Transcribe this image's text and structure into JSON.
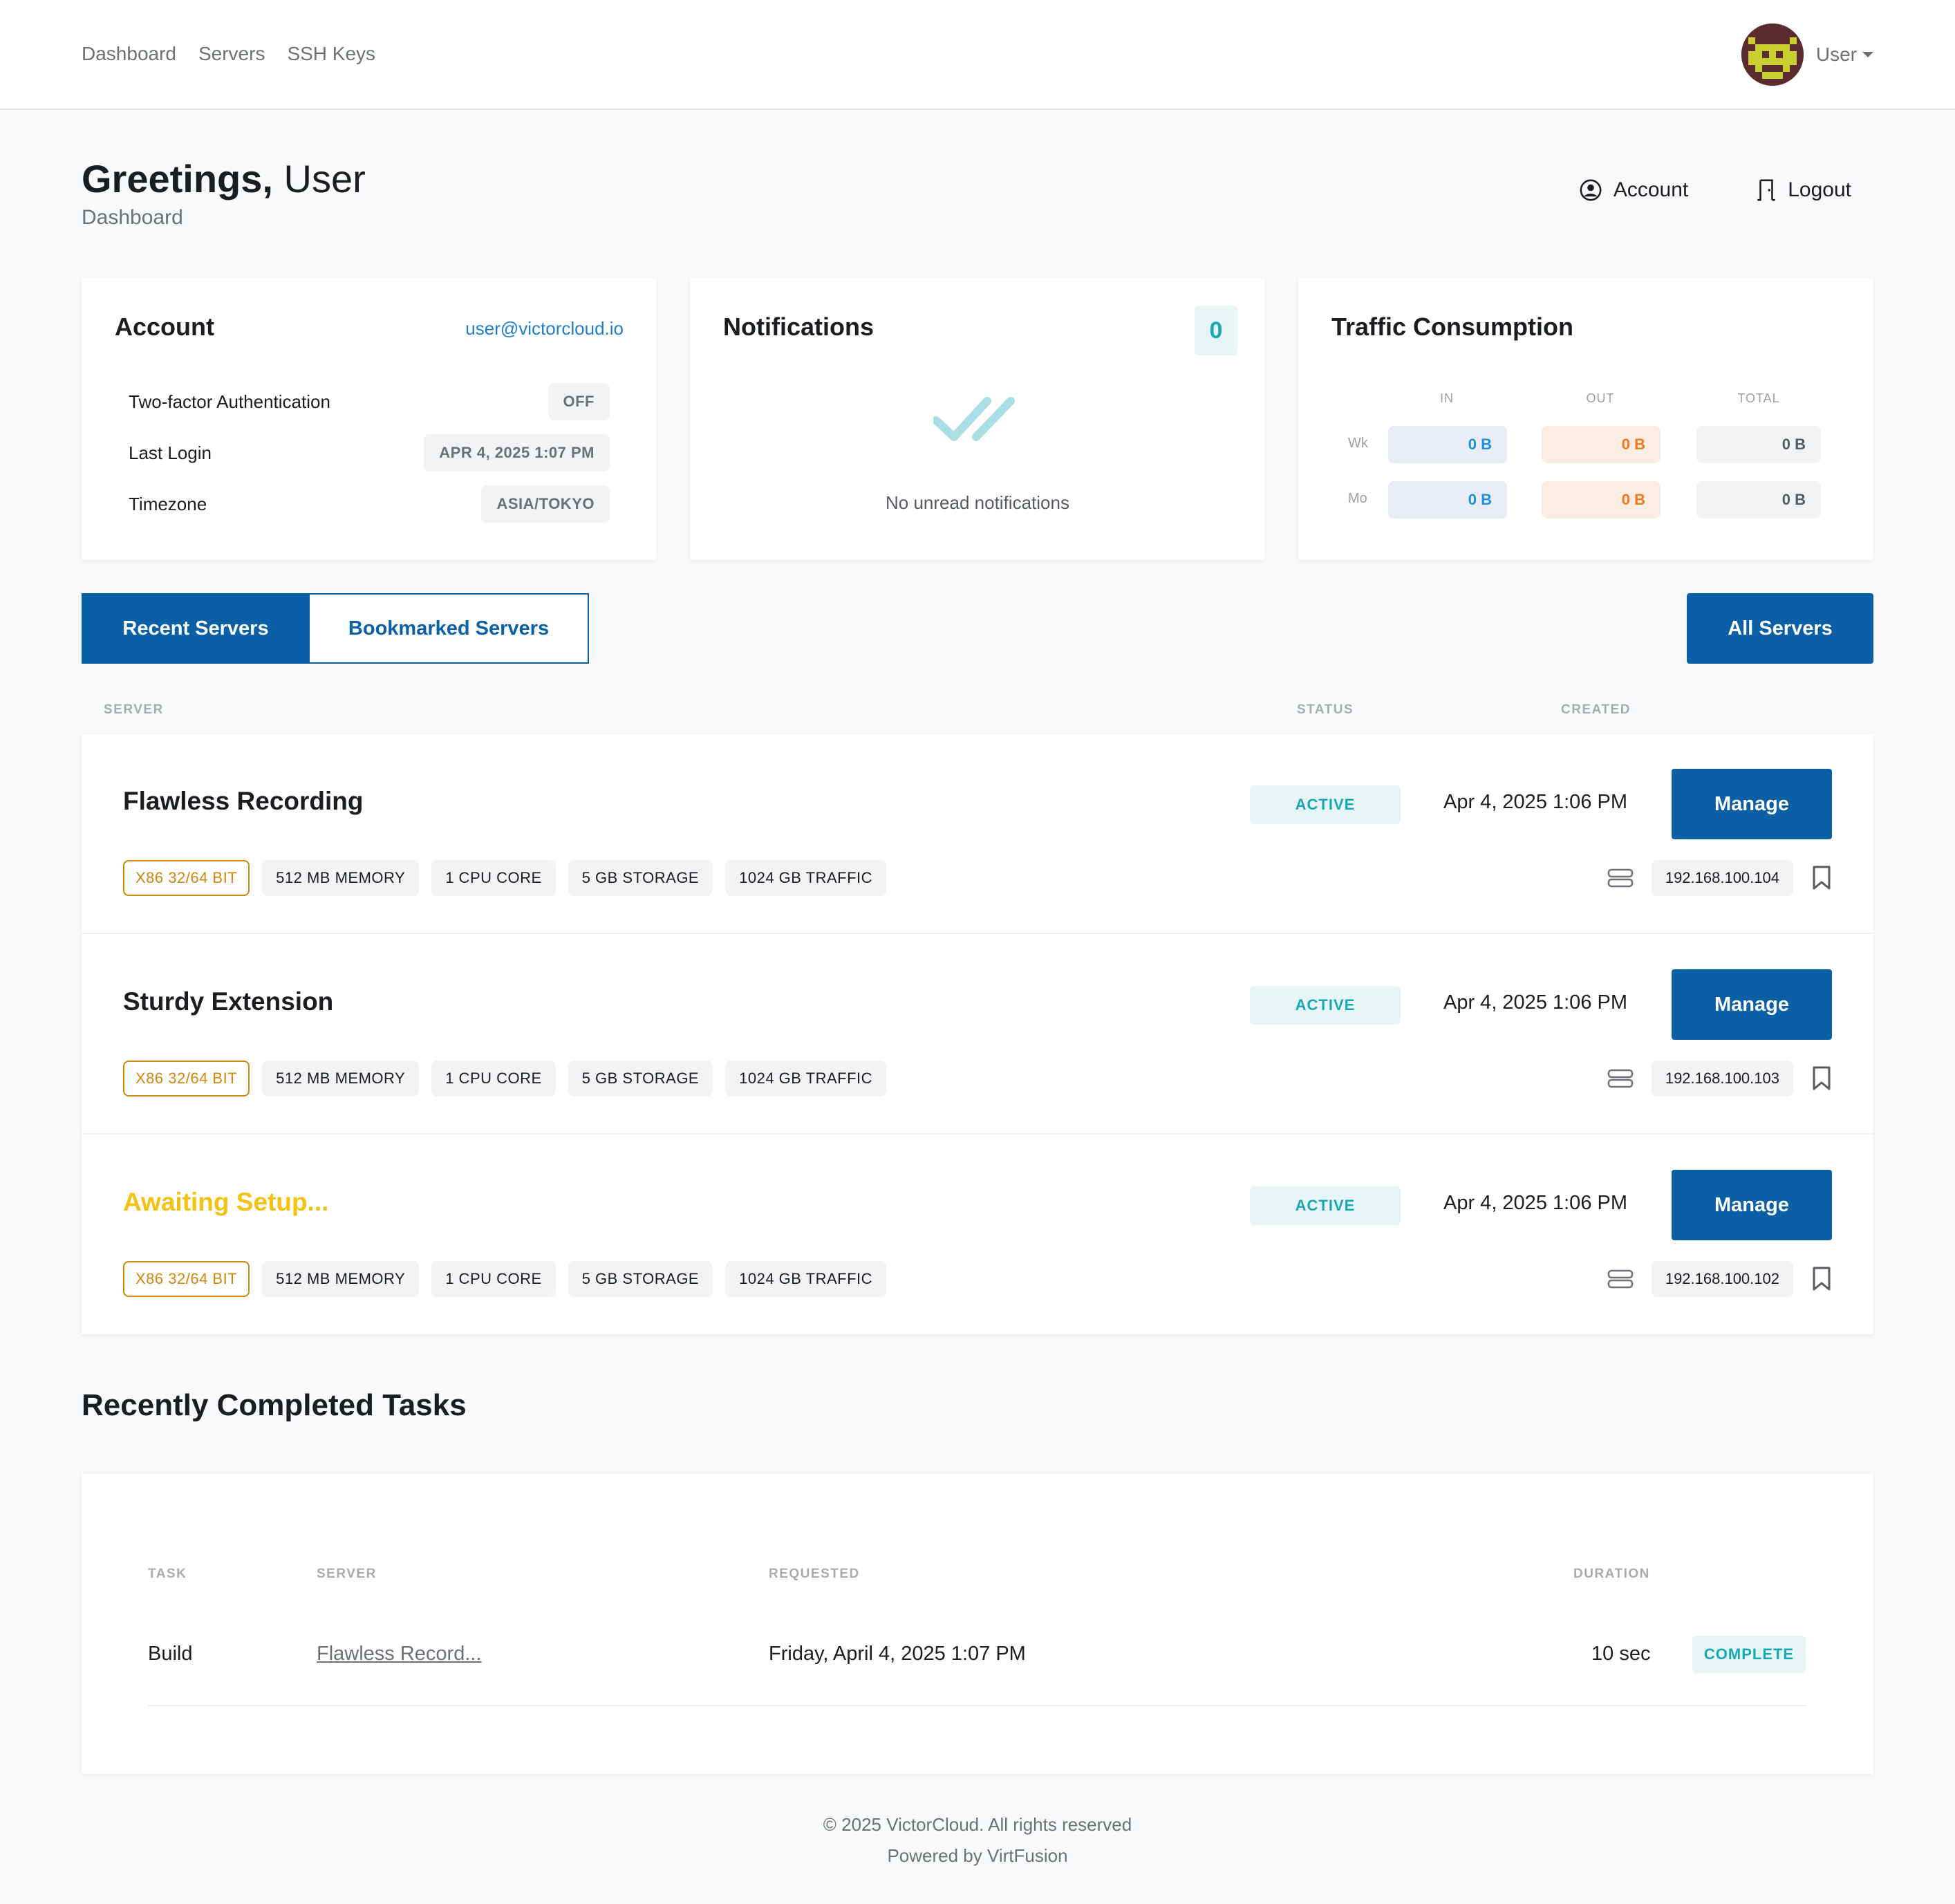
{
  "nav": {
    "links": [
      "Dashboard",
      "Servers",
      "SSH Keys"
    ],
    "user_label": "User"
  },
  "header": {
    "greeting": "Greetings,",
    "user": "User",
    "subtitle": "Dashboard",
    "account_label": "Account",
    "logout_label": "Logout"
  },
  "account_card": {
    "title": "Account",
    "email": "user@victorcloud.io",
    "rows": [
      {
        "label": "Two-factor Authentication",
        "value": "OFF"
      },
      {
        "label": "Last Login",
        "value": "APR 4, 2025 1:07 PM"
      },
      {
        "label": "Timezone",
        "value": "ASIA/TOKYO"
      }
    ]
  },
  "notifications_card": {
    "title": "Notifications",
    "count": "0",
    "empty_text": "No unread notifications"
  },
  "traffic_card": {
    "title": "Traffic Consumption",
    "columns": [
      "IN",
      "OUT",
      "TOTAL"
    ],
    "rows": [
      {
        "label": "Wk",
        "in": "0 B",
        "out": "0 B",
        "total": "0 B"
      },
      {
        "label": "Mo",
        "in": "0 B",
        "out": "0 B",
        "total": "0 B"
      }
    ]
  },
  "tabs": {
    "recent": "Recent Servers",
    "bookmarked": "Bookmarked Servers",
    "all_servers": "All Servers"
  },
  "server_columns": {
    "server": "SERVER",
    "status": "STATUS",
    "created": "CREATED"
  },
  "servers": [
    {
      "name": "Flawless Recording",
      "status": "ACTIVE",
      "created": "Apr 4, 2025 1:06 PM",
      "manage": "Manage",
      "specs": [
        "X86 32/64 BIT",
        "512 MB MEMORY",
        "1 CPU CORE",
        "5 GB STORAGE",
        "1024 GB TRAFFIC"
      ],
      "ip": "192.168.100.104"
    },
    {
      "name": "Sturdy Extension",
      "status": "ACTIVE",
      "created": "Apr 4, 2025 1:06 PM",
      "manage": "Manage",
      "specs": [
        "X86 32/64 BIT",
        "512 MB MEMORY",
        "1 CPU CORE",
        "5 GB STORAGE",
        "1024 GB TRAFFIC"
      ],
      "ip": "192.168.100.103"
    },
    {
      "name": "Awaiting Setup...",
      "status": "ACTIVE",
      "created": "Apr 4, 2025 1:06 PM",
      "manage": "Manage",
      "specs": [
        "X86 32/64 BIT",
        "512 MB MEMORY",
        "1 CPU CORE",
        "5 GB STORAGE",
        "1024 GB TRAFFIC"
      ],
      "ip": "192.168.100.102"
    }
  ],
  "tasks": {
    "title": "Recently Completed Tasks",
    "columns": {
      "task": "TASK",
      "server": "SERVER",
      "requested": "REQUESTED",
      "duration": "DURATION"
    },
    "rows": [
      {
        "task": "Build",
        "server": "Flawless Record...",
        "requested": "Friday, April 4, 2025 1:07 PM",
        "duration": "10 sec",
        "status": "COMPLETE"
      }
    ]
  },
  "footer": {
    "copyright": "© 2025 VictorCloud. All rights reserved",
    "powered": "Powered by VirtFusion"
  },
  "colors": {
    "primary": "#0b5fa5",
    "teal": "#19a7b5",
    "pending": "#f5c211",
    "arch": "#d4860b",
    "traffic_in": "#1e90d6",
    "traffic_out": "#f07a1a"
  }
}
